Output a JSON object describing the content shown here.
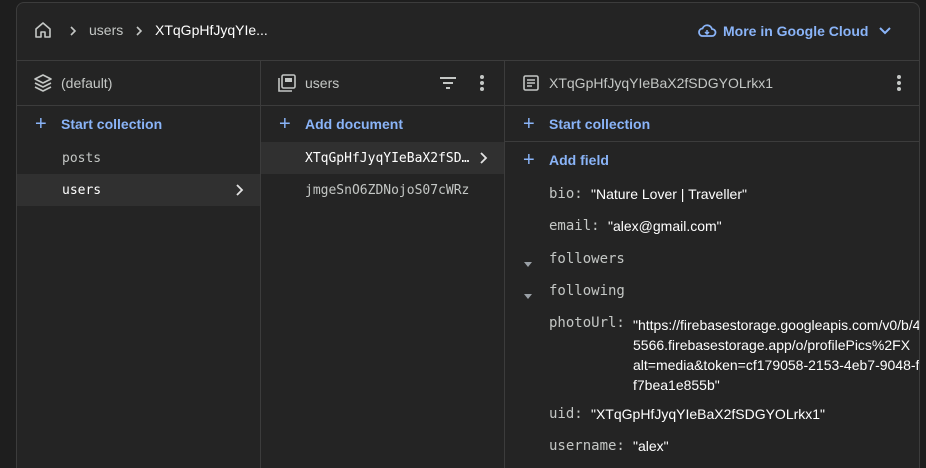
{
  "breadcrumb": {
    "home_icon": "home-icon",
    "items": [
      "users",
      "XTqGpHfJyqYIe..."
    ]
  },
  "header": {
    "cloud_label": "More in Google Cloud",
    "cloud_icon": "cloud-icon"
  },
  "columns": {
    "root": {
      "title": "(default)",
      "add_label": "Start collection",
      "collections": [
        "posts",
        "users"
      ],
      "selected": "users"
    },
    "collection": {
      "title": "users",
      "add_label": "Add document",
      "documents": [
        "XTqGpHfJyqYIeBaX2fSDGYOLrkx1",
        "jmgeSnO6ZDNojoS07cWRz"
      ],
      "selected": "XTqGpHfJyqYIeBaX2fSDGYOLrkx1"
    },
    "document": {
      "title": "XTqGpHfJyqYIeBaX2fSDGYOLrkx1",
      "start_collection_label": "Start collection",
      "add_field_label": "Add field",
      "fields": {
        "bio": {
          "key": "bio:",
          "value": "\"Nature Lover | Traveller\""
        },
        "email": {
          "key": "email:",
          "value": "\"alex@gmail.com\""
        },
        "followers": {
          "key": "followers"
        },
        "following": {
          "key": "following"
        },
        "photoUrl": {
          "key": "photoUrl:",
          "value": "\"https://firebasestorage.googleapis.com/v0/b/45566.firebasestorage.app/o/profilePics%2FX alt=media&token=cf179058-2153-4eb7-9048-ff7bea1e855b\""
        },
        "uid": {
          "key": "uid:",
          "value": "\"XTqGpHfJyqYIeBaX2fSDGYOLrkx1\""
        },
        "username": {
          "key": "username:",
          "value": "\"alex\""
        }
      }
    }
  },
  "colors": {
    "accent": "#8ab4f8",
    "background": "#242424",
    "border": "#3c3c3c",
    "selected": "#303030"
  }
}
